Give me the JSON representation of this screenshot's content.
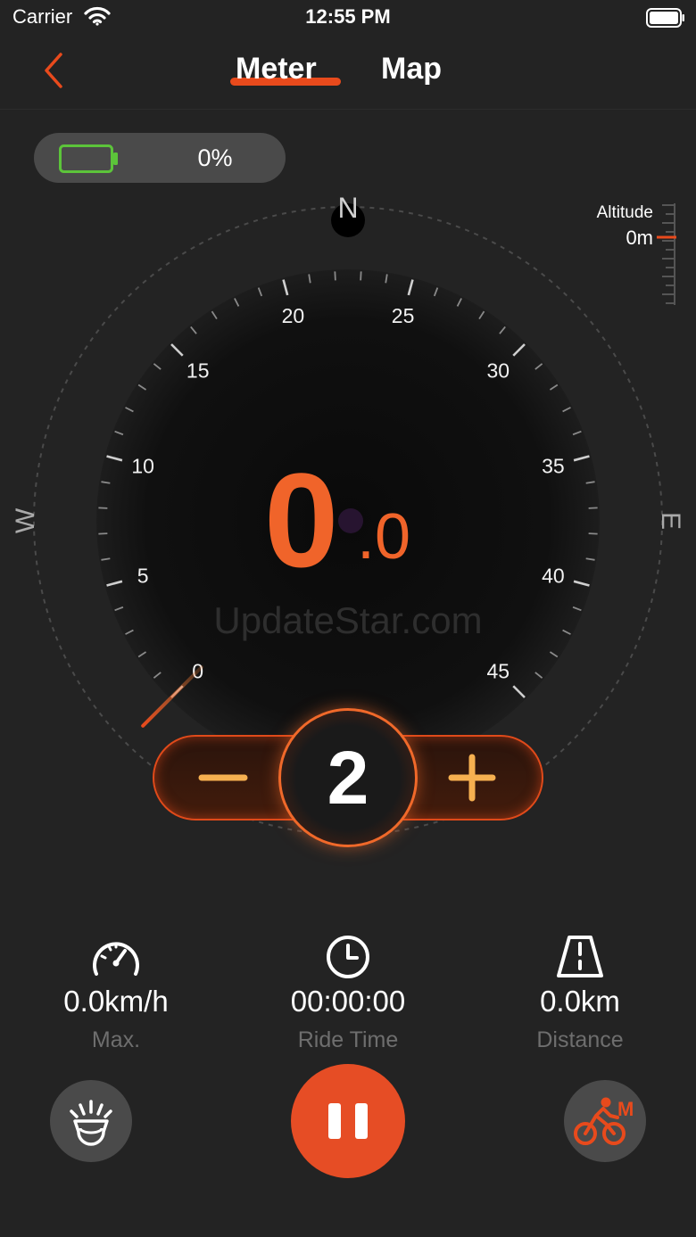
{
  "status_bar": {
    "carrier": "Carrier",
    "time": "12:55 PM"
  },
  "nav": {
    "tabs": [
      {
        "label": "Meter",
        "active": true
      },
      {
        "label": "Map",
        "active": false
      }
    ]
  },
  "battery": {
    "percent_text": "0%",
    "level": 0
  },
  "altitude": {
    "label": "Altitude",
    "value": "0m"
  },
  "compass": {
    "n": "N",
    "e": "E",
    "w": "W"
  },
  "gauge": {
    "min": 0,
    "max": 45,
    "tick_labels": [
      "0",
      "5",
      "10",
      "15",
      "20",
      "25",
      "30",
      "35",
      "40",
      "45"
    ],
    "needle_value": 0
  },
  "speed": {
    "integer": "0",
    "decimal": ".0"
  },
  "watermark": "UpdateStar.com",
  "assist": {
    "level": "2",
    "minus": "−",
    "plus": "+"
  },
  "stats": {
    "max": {
      "value": "0.0km/h",
      "label": "Max."
    },
    "ride_time": {
      "value": "00:00:00",
      "label": "Ride Time"
    },
    "distance": {
      "value": "0.0km",
      "label": "Distance"
    }
  },
  "colors": {
    "accent": "#e84a1c",
    "speed": "#f0642a",
    "battery": "#5cc43a",
    "background": "#232323"
  },
  "icons": {
    "back": "chevron-left-icon",
    "battery": "battery-icon",
    "speedometer": "speedometer-icon",
    "clock": "clock-icon",
    "road": "road-icon",
    "headlight": "headlight-icon",
    "pause": "pause-icon",
    "bike_mode": "bike-mode-icon"
  },
  "mode_badge": "M"
}
